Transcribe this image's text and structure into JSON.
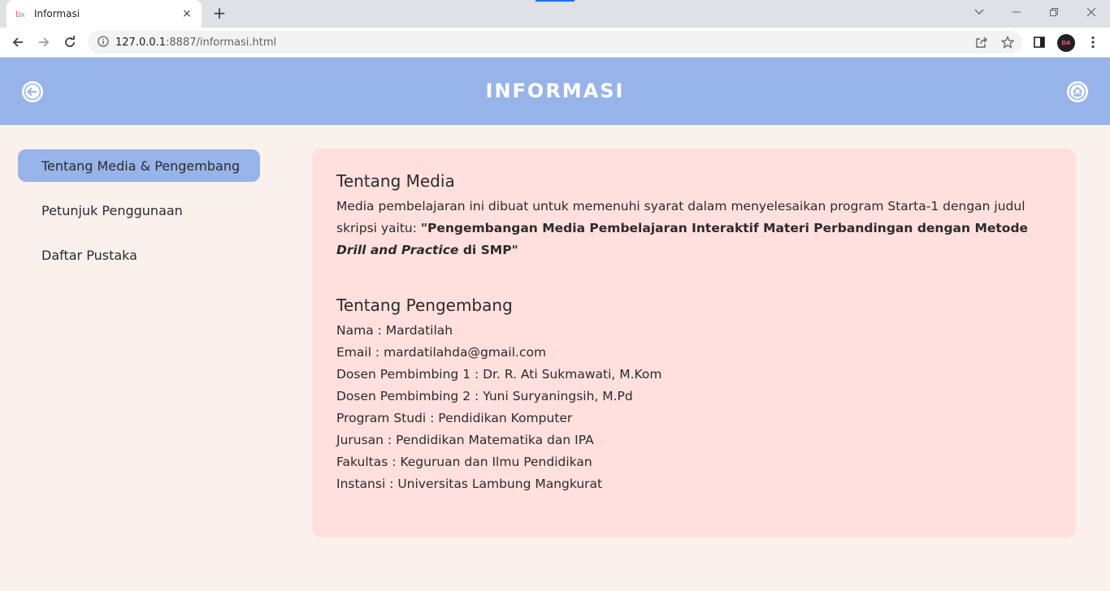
{
  "browser": {
    "tab_title": "Informasi",
    "tab_close": "×",
    "new_tab": "+",
    "url_host": "127.0.0.1",
    "url_rest": ":8887/informasi.html",
    "profile_initials": "DA"
  },
  "header": {
    "title": "INFORMASI"
  },
  "sidebar": {
    "items": [
      {
        "label": "Tentang Media & Pengembang"
      },
      {
        "label": "Petunjuk Penggunaan"
      },
      {
        "label": "Daftar Pustaka"
      }
    ]
  },
  "content": {
    "media_title": "Tentang Media",
    "media_text_1": "Media pembelajaran ini dibuat untuk memenuhi syarat dalam menyelesaikan program Starta-1 dengan judul skripsi yaitu: ",
    "media_bold_1": "\"Pengembangan Media Pembelajaran Interaktif Materi Perbandingan dengan Metode ",
    "media_bold_italic": "Drill and Practice",
    "media_bold_2": " di SMP\"",
    "dev_title": "Tentang Pengembang",
    "dev_lines": [
      "Nama : Mardatilah",
      "Email : mardatilahda@gmail.com",
      "Dosen Pembimbing 1 : Dr. R. Ati Sukmawati, M.Kom",
      "Dosen Pembimbing 2 : Yuni Suryaningsih, M.Pd",
      "Program Studi : Pendidikan Komputer",
      "Jurusan : Pendidikan Matematika dan IPA",
      "Fakultas : Keguruan dan Ilmu Pendidikan",
      "Instansi : Universitas Lambung Mangkurat"
    ]
  },
  "colors": {
    "header_bg": "#97b4ea",
    "active_item_bg": "#97b4ea",
    "content_bg": "#ffe0df",
    "page_bg": "#fbf1ec"
  }
}
